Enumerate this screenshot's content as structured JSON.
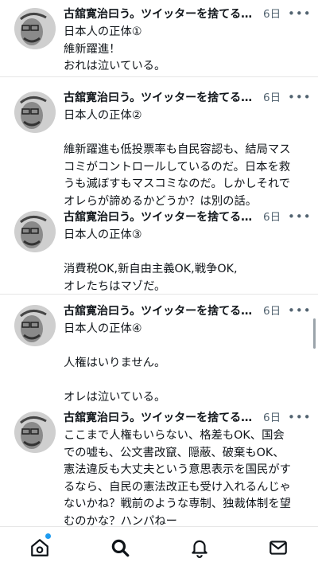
{
  "feed": {
    "tweets": [
      {
        "name": "古舘寛治曰う。ツイッターを捨てるべき",
        "date": "6日",
        "more": "•••",
        "lines": [
          "日本人の正体①",
          "維新躍進！",
          "おれは泣いている。"
        ]
      },
      {
        "name": "古舘寛治曰う。ツイッターを捨てるべき",
        "date": "6日",
        "more": "•••",
        "lines": [
          "日本人の正体②",
          "",
          "維新躍進も低投票率も自民容認も、結局マス",
          "コミがコントロールしているのだ。日本を救",
          "うも滅ぼすもマスコミなのだ。しかしそれで",
          "オレらが諦めるかどうか？は別の話。"
        ]
      },
      {
        "name": "古舘寛治曰う。ツイッターを捨てるべき",
        "date": "6日",
        "more": "•••",
        "lines": [
          "日本人の正体③",
          "",
          "消費税OK,新自由主義OK,戦争OK,",
          "オレたちはマゾだ。"
        ]
      },
      {
        "name": "古舘寛治曰う。ツイッターを捨てるべき",
        "date": "6日",
        "more": "•••",
        "lines": [
          "日本人の正体④",
          "",
          "人権はいりません。",
          "",
          "オレは泣いている。"
        ]
      },
      {
        "name": "古舘寛治曰う。ツイッターを捨てるべき",
        "date": "6日",
        "more": "•••",
        "lines": [
          "ここまで人権もいらない、格差もOK、国会",
          "での嘘も、公文書改竄、隠蔽、破棄もOK、",
          "憲法違反も大丈夫という意思表示を国民がす",
          "るなら、自民の憲法改正も受け入れるんじゃ",
          "ないかね？戦前のような専制、独裁体制を望",
          "むのかな？ハンパねー"
        ]
      }
    ]
  },
  "tabbar": {
    "tabs": [
      {
        "icon": "home-icon",
        "notification": true
      },
      {
        "icon": "search-icon"
      },
      {
        "icon": "bell-icon"
      },
      {
        "icon": "mail-icon"
      }
    ]
  },
  "colors": {
    "accent": "#1d9bf0",
    "text": "#0f1419",
    "muted": "#536471"
  }
}
